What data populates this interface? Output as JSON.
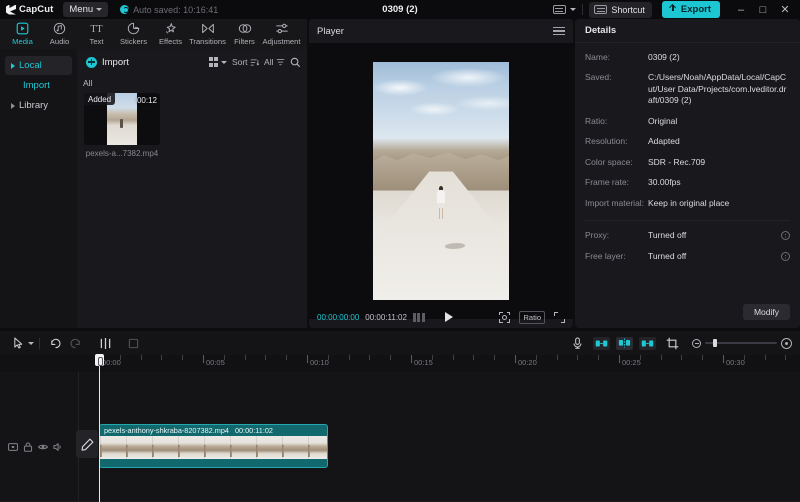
{
  "titlebar": {
    "app_name": "CapCut",
    "menu_label": "Menu",
    "autosave_text": "Auto saved: 10:16:41",
    "project_title": "0309 (2)",
    "shortcut_label": "Shortcut",
    "export_label": "Export",
    "minimize": "–",
    "maximize": "□",
    "close": "✕"
  },
  "tabs": [
    {
      "label": "Media",
      "icon": "media-icon",
      "active": true
    },
    {
      "label": "Audio",
      "icon": "audio-icon",
      "active": false
    },
    {
      "label": "Text",
      "icon": "text-icon",
      "active": false
    },
    {
      "label": "Stickers",
      "icon": "stickers-icon",
      "active": false
    },
    {
      "label": "Effects",
      "icon": "effects-icon",
      "active": false
    },
    {
      "label": "Transitions",
      "icon": "transitions-icon",
      "active": false
    },
    {
      "label": "Filters",
      "icon": "filters-icon",
      "active": false
    },
    {
      "label": "Adjustment",
      "icon": "adjustment-icon",
      "active": false
    }
  ],
  "leftnav": {
    "items": [
      {
        "label": "Local",
        "selected": true
      },
      {
        "label": "Import",
        "selected": false
      },
      {
        "label": "Library",
        "selected": false
      }
    ]
  },
  "media": {
    "import_label": "Import",
    "view_label": "",
    "sort_label": "Sort",
    "filter_label": "All",
    "search_label": "",
    "category_label": "All",
    "items": [
      {
        "badge": "Added",
        "duration": "00:12",
        "name": "pexels-a...7382.mp4"
      }
    ]
  },
  "player": {
    "title": "Player",
    "current_time": "00:00:00:00",
    "total_time": "00:00:11:02",
    "ratio_label": "Ratio"
  },
  "details": {
    "title": "Details",
    "rows": [
      {
        "label": "Name:",
        "value": "0309 (2)"
      },
      {
        "label": "Saved:",
        "value": "C:/Users/Noah/AppData/Local/CapCut/User Data/Projects/com.lveditor.draft/0309 (2)"
      },
      {
        "label": "Ratio:",
        "value": "Original"
      },
      {
        "label": "Resolution:",
        "value": "Adapted"
      },
      {
        "label": "Color space:",
        "value": "SDR - Rec.709"
      },
      {
        "label": "Frame rate:",
        "value": "30.00fps"
      },
      {
        "label": "Import material:",
        "value": "Keep in original place"
      }
    ],
    "toggles": [
      {
        "label": "Proxy:",
        "value": "Turned off"
      },
      {
        "label": "Free layer:",
        "value": "Turned off"
      }
    ],
    "modify_label": "Modify"
  },
  "timeline": {
    "ruler_labels": [
      "00:00",
      "00:05",
      "00:10",
      "00:15",
      "00:20",
      "00:25",
      "00:30"
    ],
    "clip": {
      "name": "pexels-anthony-shkraba-8207382.mp4",
      "duration": "00:00:11:02"
    }
  },
  "colors": {
    "accent": "#1ec8d4",
    "export": "#1cc6d2",
    "clip": "#11696e",
    "background": "#141417"
  }
}
